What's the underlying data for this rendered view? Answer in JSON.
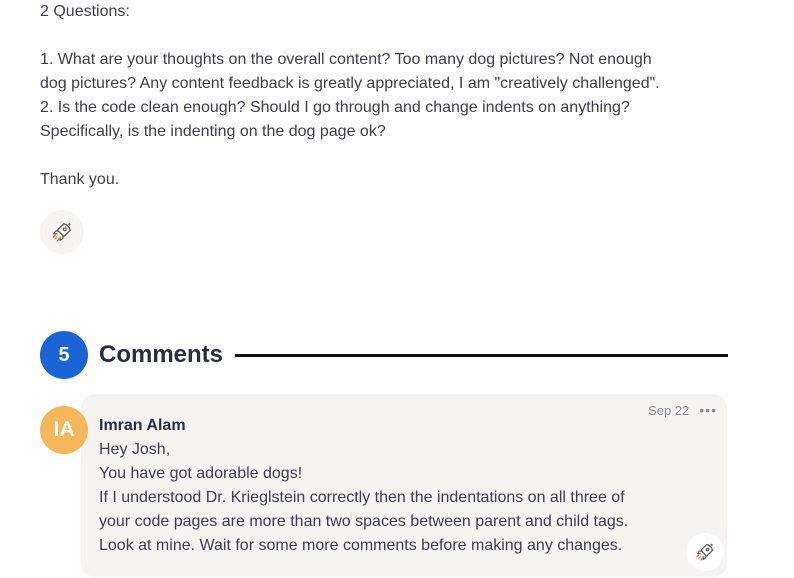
{
  "post": {
    "lines": [
      "2 Questions:",
      "",
      "1. What are your thoughts on the overall content? Too many dog pictures? Not enough",
      "dog pictures? Any content feedback is greatly appreciated, I am \"creatively challenged\".",
      "2. Is the code clean enough? Should I go through and change indents on anything?",
      "Specifically, is the indenting on the dog page ok?",
      "",
      "Thank you."
    ]
  },
  "reaction_icon": "rocket-reaction-icon",
  "comments_section": {
    "count": "5",
    "title": "Comments",
    "accent_color": "#1a64d6"
  },
  "comments": [
    {
      "avatar_initials": "IA",
      "avatar_color": "#f6b65b",
      "author": "Imran Alam",
      "date": "Sep 22",
      "more_label": "•••",
      "lines": [
        "Hey Josh,",
        "You have got adorable dogs!",
        "If I understood Dr. Krieglstein correctly then the indentations on all three of",
        "your code pages are more than two spaces between parent and child tags.",
        "Look at mine. Wait for some more comments before making any changes."
      ]
    }
  ]
}
